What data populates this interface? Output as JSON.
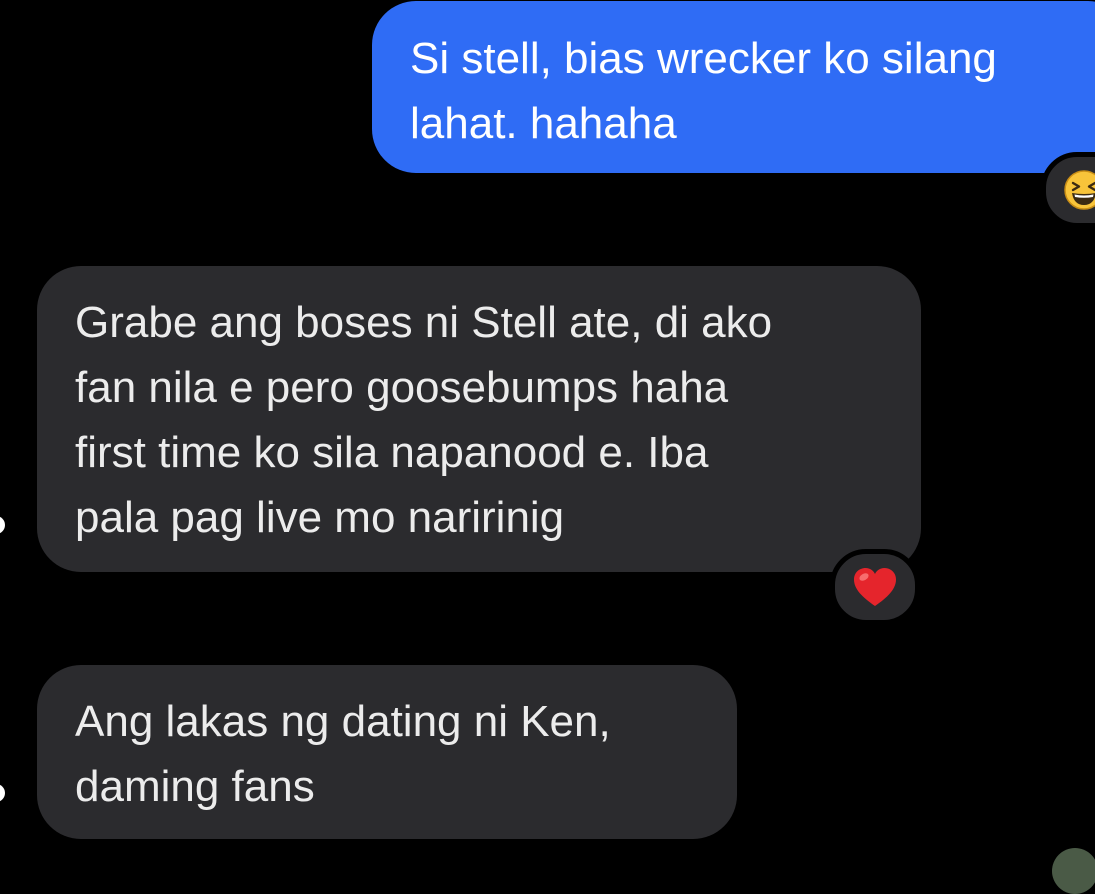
{
  "conversation": {
    "messages": [
      {
        "direction": "sent",
        "text": "Si stell, bias wrecker ko silang\nlahat. hahaha"
      },
      {
        "direction": "received",
        "text": "Grabe ang boses ni Stell ate, di ako\nfan nila e pero goosebumps haha\nfirst time ko sila napanood e. Iba\npala pag live mo naririnig"
      },
      {
        "direction": "received",
        "text": "Ang lakas ng dating ni Ken,\ndaming fans"
      }
    ],
    "reactions": [
      {
        "message_index": 0,
        "icon": "grinning-squinting-face-icon"
      },
      {
        "message_index": 1,
        "icon": "red-heart-icon"
      }
    ]
  },
  "colors": {
    "background": "#000000",
    "sent_bubble": "#2f6cf5",
    "received_bubble": "#2b2b2e",
    "text": "#ececec",
    "heart": "#e5252c",
    "emoji_face": "#f8c43a"
  }
}
